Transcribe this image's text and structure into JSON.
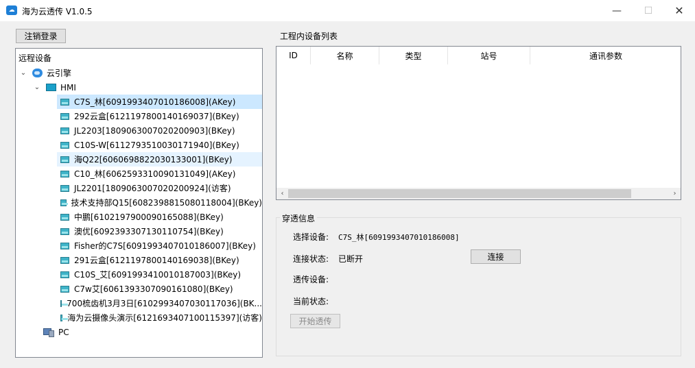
{
  "window": {
    "title": "海为云透传 V1.0.5",
    "icon": "cloud-icon",
    "min_glyph": "—",
    "max_glyph": "☐",
    "close_glyph": "✕"
  },
  "logout_button": "注销登录",
  "tree": {
    "header": "远程设备",
    "cloud_node": "云引擎",
    "hmi_node": "HMI",
    "pc_node": "PC",
    "expanded_glyph": "⌄",
    "devices": [
      "C7S_林[6091993407010186008](AKey)",
      "292云盒[6121197800140169037](BKey)",
      "JL2203[1809063007020200903](BKey)",
      "C10S-W[6112793510030171940](BKey)",
      "海Q22[6060698822030133001](BKey)",
      "C10_林[6062593310090131049](AKey)",
      "JL2201[1809063007020200924](访客)",
      "技术支持部Q15[6082398815080118004](BKey)",
      "中鹏[6102197900090165088](BKey)",
      "澳优[6092393307130110754](BKey)",
      "Fisher的C7S[6091993407010186007](BKey)",
      "291云盒[6121197800140169038](BKey)",
      "C10S_艾[6091993410010187003](BKey)",
      "C7w艾[6061393307090161080](BKey)",
      "700梳齿机3月3日[6102993407030117036](BK...",
      "海为云摄像头演示[6121693407100115397](访客)"
    ]
  },
  "device_list": {
    "label": "工程内设备列表",
    "columns": [
      "ID",
      "名称",
      "类型",
      "站号",
      "通讯参数"
    ],
    "scroll_left": "‹",
    "scroll_right": "›"
  },
  "transparent": {
    "group_title": "穿透信息",
    "select_device_label": "选择设备:",
    "select_device_value": "C7S_林[6091993407010186008]",
    "connection_label": "连接状态:",
    "connection_value": "已断开",
    "connect_button": "连接",
    "passthrough_label": "透传设备:",
    "current_state_label": "当前状态:",
    "start_button": "开始透传"
  }
}
